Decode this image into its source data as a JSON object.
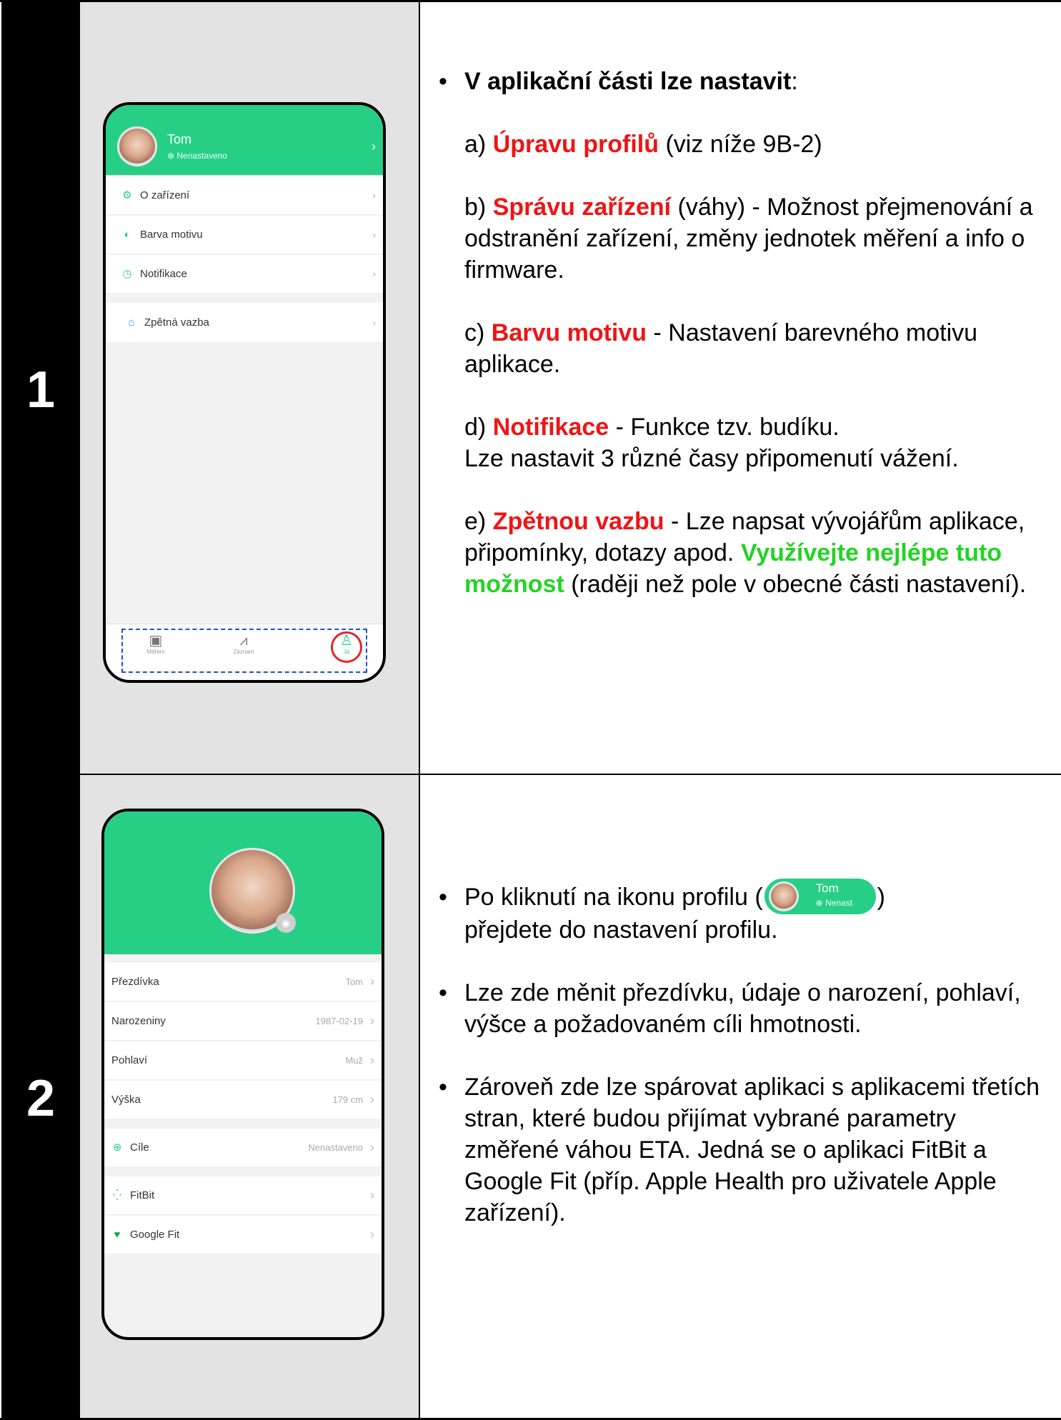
{
  "steps": [
    {
      "number": "1"
    },
    {
      "number": "2"
    }
  ],
  "step1": {
    "heading": "V aplikační části lze nastavit",
    "heading_colon": ":",
    "items": [
      {
        "prefix": "a) ",
        "highlight": "Úpravu profilů",
        "rest": " (viz níže 9B-2)"
      },
      {
        "prefix": "b) ",
        "highlight": "Správu zařízení",
        "rest": " (váhy) - Možnost přejmenování a odstranění zařízení, změny jednotek měření a info o firmware."
      },
      {
        "prefix": "c) ",
        "highlight": "Barvu motivu",
        "rest": " - Nastavení barevného motivu aplikace."
      },
      {
        "prefix": "d) ",
        "highlight": "Notifikace",
        "rest": " - Funkce tzv. budíku.",
        "rest2": "Lze nastavit 3 různé časy připomenutí vážení."
      },
      {
        "prefix": "e) ",
        "highlight": "Zpětnou vazbu",
        "rest": " - Lze napsat vývojářům aplikace, připomínky, dotazy apod. ",
        "green": "Využívejte nejlépe tuto možnost",
        "rest2": " (raději než pole v obecné části nastavení)."
      }
    ],
    "phone": {
      "user_name": "Tom",
      "user_status": "Nenastaveno",
      "menu": [
        {
          "label": "O zařízení",
          "icon": "gear-icon"
        },
        {
          "label": "Barva motivu",
          "icon": "palette-icon"
        },
        {
          "label": "Notifikace",
          "icon": "alarm-clock-icon"
        },
        {
          "label": "Zpětná vazba",
          "icon": "feedback-icon"
        }
      ],
      "tabs": [
        {
          "label": "Měření",
          "icon": "scale-icon"
        },
        {
          "label": "Záznam",
          "icon": "chart-icon"
        },
        {
          "label": "Já",
          "icon": "person-icon"
        }
      ]
    }
  },
  "step2": {
    "bullets": [
      {
        "before": "Po kliknutí na ikonu profilu (",
        "after": ")",
        "line2": "přejdete do nastavení profilu."
      },
      {
        "text": "Lze zde měnit přezdívku, údaje o narození, pohlaví, výšce a požadovaném cíli hmotnosti."
      },
      {
        "text": "Zároveň zde lze spárovat aplikaci s aplikacemi třetích stran, které budou přijímat vybrané parametry změřené váhou ETA. Jedná se o aplikaci FitBit a Google Fit (příp. Apple Health pro uživatele Apple zařízení)."
      }
    ],
    "chip": {
      "name": "Tom",
      "status": "Nenast"
    },
    "phone": {
      "rows": [
        {
          "label": "Přezdívka",
          "value": "Tom"
        },
        {
          "label": "Narozeniny",
          "value": "1987-02-19"
        },
        {
          "label": "Pohlaví",
          "value": "Muž"
        },
        {
          "label": "Výška",
          "value": "179 cm"
        }
      ],
      "goal": {
        "label": "Cíle",
        "value": "Nenastaveno"
      },
      "apps": [
        {
          "label": "FitBit",
          "icon": "fitbit-icon"
        },
        {
          "label": "Google Fit",
          "icon": "heart-icon"
        }
      ]
    }
  },
  "colors": {
    "accent": "#27cf86",
    "highlight_red": "#f01414",
    "highlight_green": "#24d324"
  }
}
